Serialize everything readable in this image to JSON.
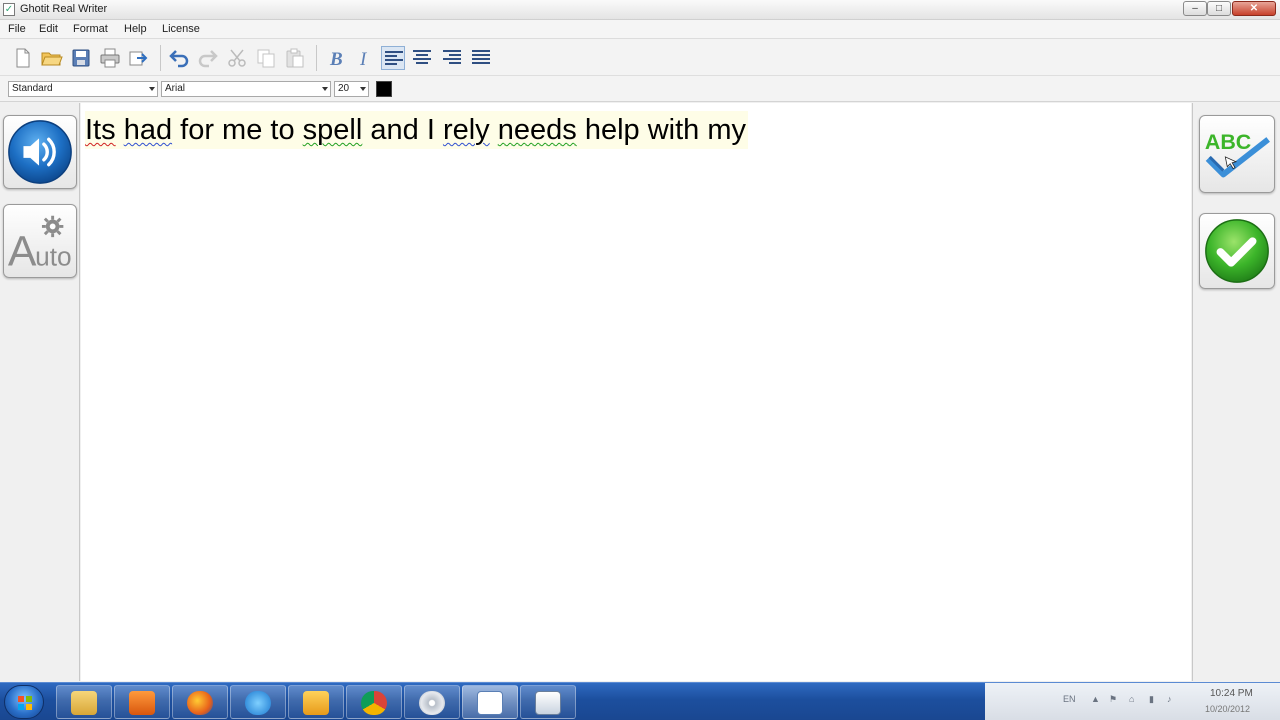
{
  "window": {
    "title": "Ghotit Real Writer",
    "buttons": {
      "minimize": "–",
      "maximize": "□",
      "close": "✕"
    }
  },
  "menu": {
    "items": [
      "File",
      "Edit",
      "Format",
      "Help",
      "License"
    ]
  },
  "toolbar": {
    "buttons": [
      "new-document",
      "open-folder",
      "save",
      "print",
      "export",
      "undo",
      "redo",
      "cut",
      "copy",
      "paste",
      "bold",
      "italic",
      "align-left",
      "align-center",
      "align-right",
      "justify"
    ],
    "bold_glyph": "B",
    "italic_glyph": "I"
  },
  "format": {
    "style": "Standard",
    "font": "Arial",
    "size": "20",
    "text_color": "#000000"
  },
  "document": {
    "words": [
      {
        "text": "Its",
        "error": "red"
      },
      {
        "text": "had",
        "error": "blue"
      },
      {
        "text": "for",
        "error": ""
      },
      {
        "text": "me",
        "error": ""
      },
      {
        "text": "to",
        "error": ""
      },
      {
        "text": "spell",
        "error": "green"
      },
      {
        "text": "and",
        "error": ""
      },
      {
        "text": "I",
        "error": ""
      },
      {
        "text": "rely",
        "error": "blue"
      },
      {
        "text": "needs",
        "error": "green"
      },
      {
        "text": "help",
        "error": ""
      },
      {
        "text": "with",
        "error": ""
      },
      {
        "text": "my",
        "error": ""
      }
    ]
  },
  "left_panel": {
    "speak_icon": "speaker-icon",
    "auto_label_big": "A",
    "auto_label_small": "uto"
  },
  "right_panel": {
    "spellcheck_label": "ABC",
    "confirm_icon": "checkmark-icon"
  },
  "taskbar": {
    "apps": [
      "explorer",
      "media-player",
      "firefox",
      "internet-explorer",
      "outlook",
      "chrome",
      "disc-app",
      "ghotit-app",
      "window-app"
    ],
    "tray": {
      "language": "EN",
      "time": "10:24 PM",
      "date": "10/20/2012"
    }
  },
  "colors": {
    "accent_blue": "#1d6fc4",
    "confirm_green": "#3cb52a",
    "text_highlight": "#fefde7"
  }
}
